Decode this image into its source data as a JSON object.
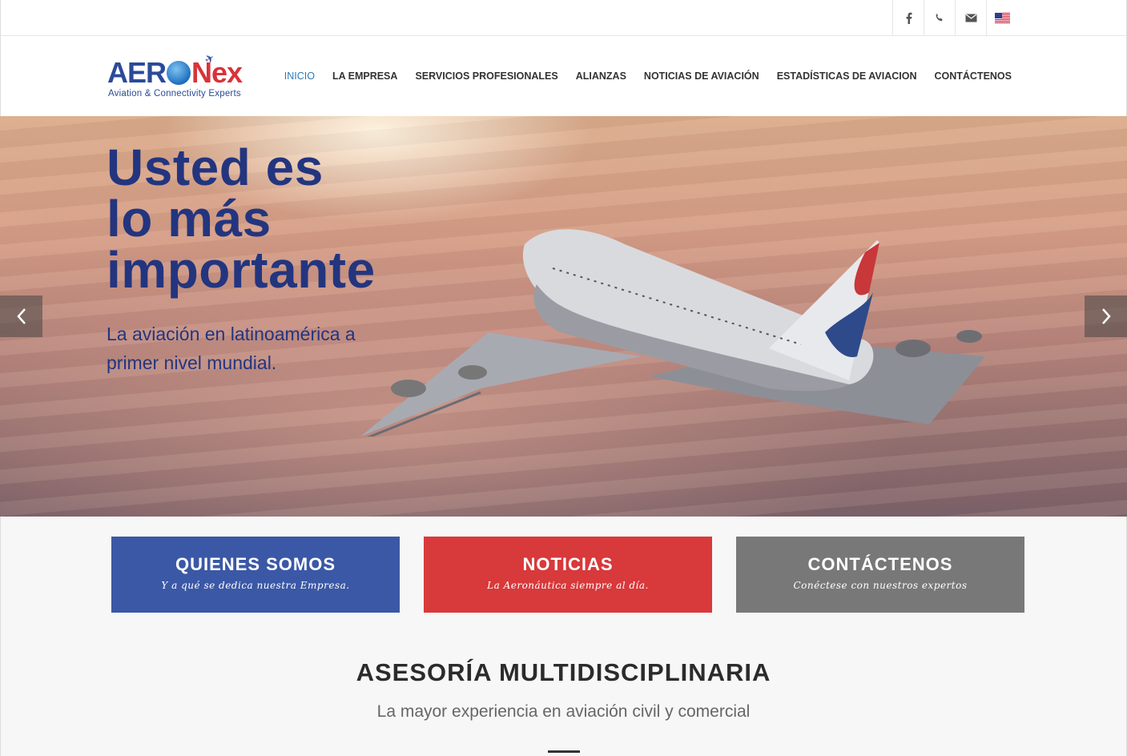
{
  "topbar": {
    "icons": [
      "facebook-icon",
      "phone-icon",
      "mail-icon",
      "us-flag-icon"
    ]
  },
  "logo": {
    "aer": "AER",
    "nex": "Nex",
    "tagline": "Aviation & Connectivity Experts"
  },
  "nav": {
    "items": [
      {
        "label": "INICIO"
      },
      {
        "label": "LA EMPRESA"
      },
      {
        "label": "SERVICIOS PROFESIONALES"
      },
      {
        "label": "ALIANZAS"
      },
      {
        "label": "NOTICIAS DE AVIACIÓN"
      },
      {
        "label": "ESTADÍSTICAS DE AVIACION"
      },
      {
        "label": "CONTÁCTENOS"
      }
    ],
    "active_color": "#2a7ab8"
  },
  "hero": {
    "title_lines": [
      "Usted es",
      "lo más",
      "importante"
    ],
    "subtitle": "La aviación en latinoamérica a primer nivel mundial.",
    "title_color": "#23357f",
    "prev_icon": "chevron-left-icon",
    "next_icon": "chevron-right-icon"
  },
  "boxes": [
    {
      "title": "QUIENES SOMOS",
      "subtitle": "Y a qué se dedica nuestra Empresa.",
      "color": "#3b58a6"
    },
    {
      "title": "NOTICIAS",
      "subtitle": "La Aeronáutica siempre al día.",
      "color": "#d8393b"
    },
    {
      "title": "CONTÁCTENOS",
      "subtitle": "Conéctese con nuestros expertos",
      "color": "#787878"
    }
  ],
  "section": {
    "title": "ASESORÍA MULTIDISCIPLINARIA",
    "subtitle": "La mayor experiencia en aviación civil y comercial"
  }
}
